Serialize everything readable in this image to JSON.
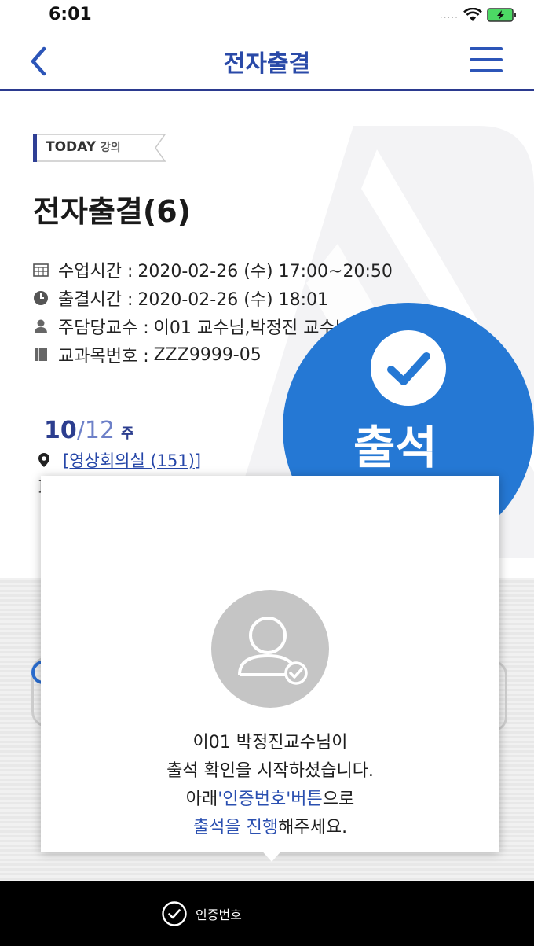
{
  "status": {
    "time": "6:01",
    "signal": "....."
  },
  "nav": {
    "title": "전자출결"
  },
  "tag": {
    "today": "TODAY",
    "lecture": "강의"
  },
  "lecture": {
    "title": "전자출결(6)",
    "info": [
      {
        "icon": "calendar-icon",
        "label": "수업시간 :",
        "value": "2020-02-26 (수) 17:00~20:50"
      },
      {
        "icon": "clock-icon",
        "label": "출결시간 :",
        "value": "2020-02-26 (수) 18:01"
      },
      {
        "icon": "person-icon",
        "label": "주담당교수 :",
        "value": "이01 교수님,박정진 교수님"
      },
      {
        "icon": "book-icon",
        "label": "교과목번호 :",
        "value": "ZZZ9999-05"
      }
    ],
    "week_current": "10",
    "week_total": "/12",
    "week_unit": "주",
    "location": "[영상회의실 (151)]",
    "stray": "]"
  },
  "attendance": {
    "label": "출석",
    "color": "#2578d4"
  },
  "popup": {
    "line1": "이01 박정진교수님이",
    "line2": "출석 확인을 시작하셨습니다.",
    "line3_prefix": "아래",
    "line3_highlight": "'인증번호'버튼",
    "line3_suffix": "으로",
    "line4_highlight": "출석을 진행",
    "line4_suffix": "해주세요."
  },
  "bottom": {
    "auth_label": "인증번호"
  },
  "colors": {
    "accent": "#2a4aa8",
    "nav_border": "#2b3a8f",
    "highlight": "#2a4fb0"
  }
}
